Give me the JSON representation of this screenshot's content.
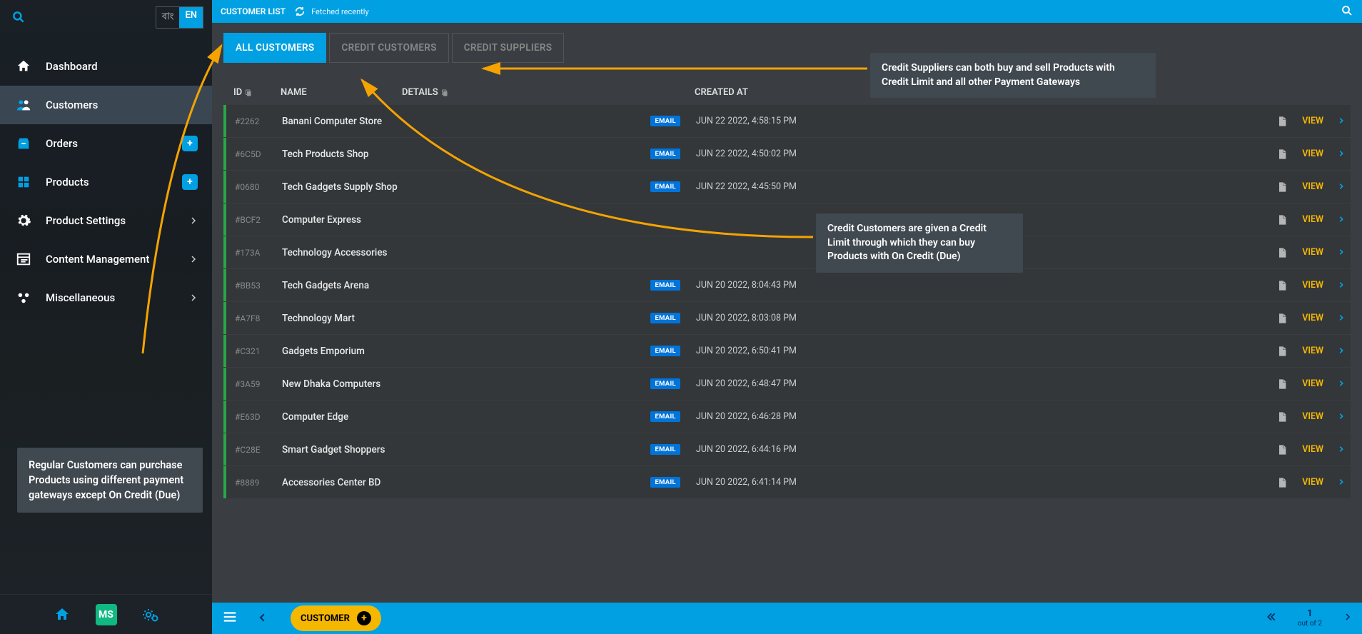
{
  "sidebar": {
    "lang_inactive": "বাং",
    "lang_active": "EN",
    "items": [
      {
        "label": "Dashboard",
        "icon": "home"
      },
      {
        "label": "Customers",
        "icon": "users",
        "active": true
      },
      {
        "label": "Orders",
        "icon": "orders",
        "plus": true
      },
      {
        "label": "Products",
        "icon": "products",
        "plus": true
      },
      {
        "label": "Product Settings",
        "icon": "gear",
        "chev": true
      },
      {
        "label": "Content Management",
        "icon": "content",
        "chev": true
      },
      {
        "label": "Miscellaneous",
        "icon": "misc",
        "chev": true
      }
    ],
    "bottom_badge": "MS"
  },
  "topbar": {
    "title": "CUSTOMER LIST",
    "fetched": "Fetched recently"
  },
  "tabs": {
    "all": "ALL CUSTOMERS",
    "credit_cust": "CREDIT CUSTOMERS",
    "credit_supp": "CREDIT SUPPLIERS"
  },
  "annotations": {
    "regular": "Regular Customers can purchase Products using different payment gateways except On Credit (Due)",
    "suppliers": "Credit Suppliers can both buy and sell Products with Credit Limit and all other Payment Gateways",
    "credit_cust": "Credit Customers are given a Credit Limit through which they can buy Products with On Credit (Due)"
  },
  "table": {
    "headers": {
      "id": "ID",
      "name": "NAME",
      "details": "DETAILS",
      "created": "CREATED AT"
    },
    "view_label": "VIEW",
    "rows": [
      {
        "id": "#2262",
        "name": "Banani Computer Store",
        "email": true,
        "created": "JUN 22 2022, 4:58:15 PM"
      },
      {
        "id": "#6C5D",
        "name": "Tech Products Shop",
        "email": true,
        "created": "JUN 22 2022, 4:50:02 PM"
      },
      {
        "id": "#0680",
        "name": "Tech Gadgets Supply Shop",
        "email": true,
        "created": "JUN 22 2022, 4:45:50 PM"
      },
      {
        "id": "#BCF2",
        "name": "Computer Express",
        "email": false,
        "created": ""
      },
      {
        "id": "#173A",
        "name": "Technology Accessories",
        "email": false,
        "created": ""
      },
      {
        "id": "#BB53",
        "name": "Tech Gadgets Arena",
        "email": true,
        "created": "JUN 20 2022, 8:04:43 PM"
      },
      {
        "id": "#A7F8",
        "name": "Technology Mart",
        "email": true,
        "created": "JUN 20 2022, 8:03:08 PM"
      },
      {
        "id": "#C321",
        "name": "Gadgets Emporium",
        "email": true,
        "created": "JUN 20 2022, 6:50:41 PM"
      },
      {
        "id": "#3A59",
        "name": "New Dhaka Computers",
        "email": true,
        "created": "JUN 20 2022, 6:48:47 PM"
      },
      {
        "id": "#E63D",
        "name": "Computer Edge",
        "email": true,
        "created": "JUN 20 2022, 6:46:28 PM"
      },
      {
        "id": "#C28E",
        "name": "Smart Gadget Shoppers",
        "email": true,
        "created": "JUN 20 2022, 6:44:16 PM"
      },
      {
        "id": "#8889",
        "name": "Accessories Center BD",
        "email": true,
        "created": "JUN 20 2022, 6:41:14 PM"
      }
    ]
  },
  "bottom": {
    "button": "CUSTOMER",
    "page": "1",
    "page_of": "out of 2"
  }
}
